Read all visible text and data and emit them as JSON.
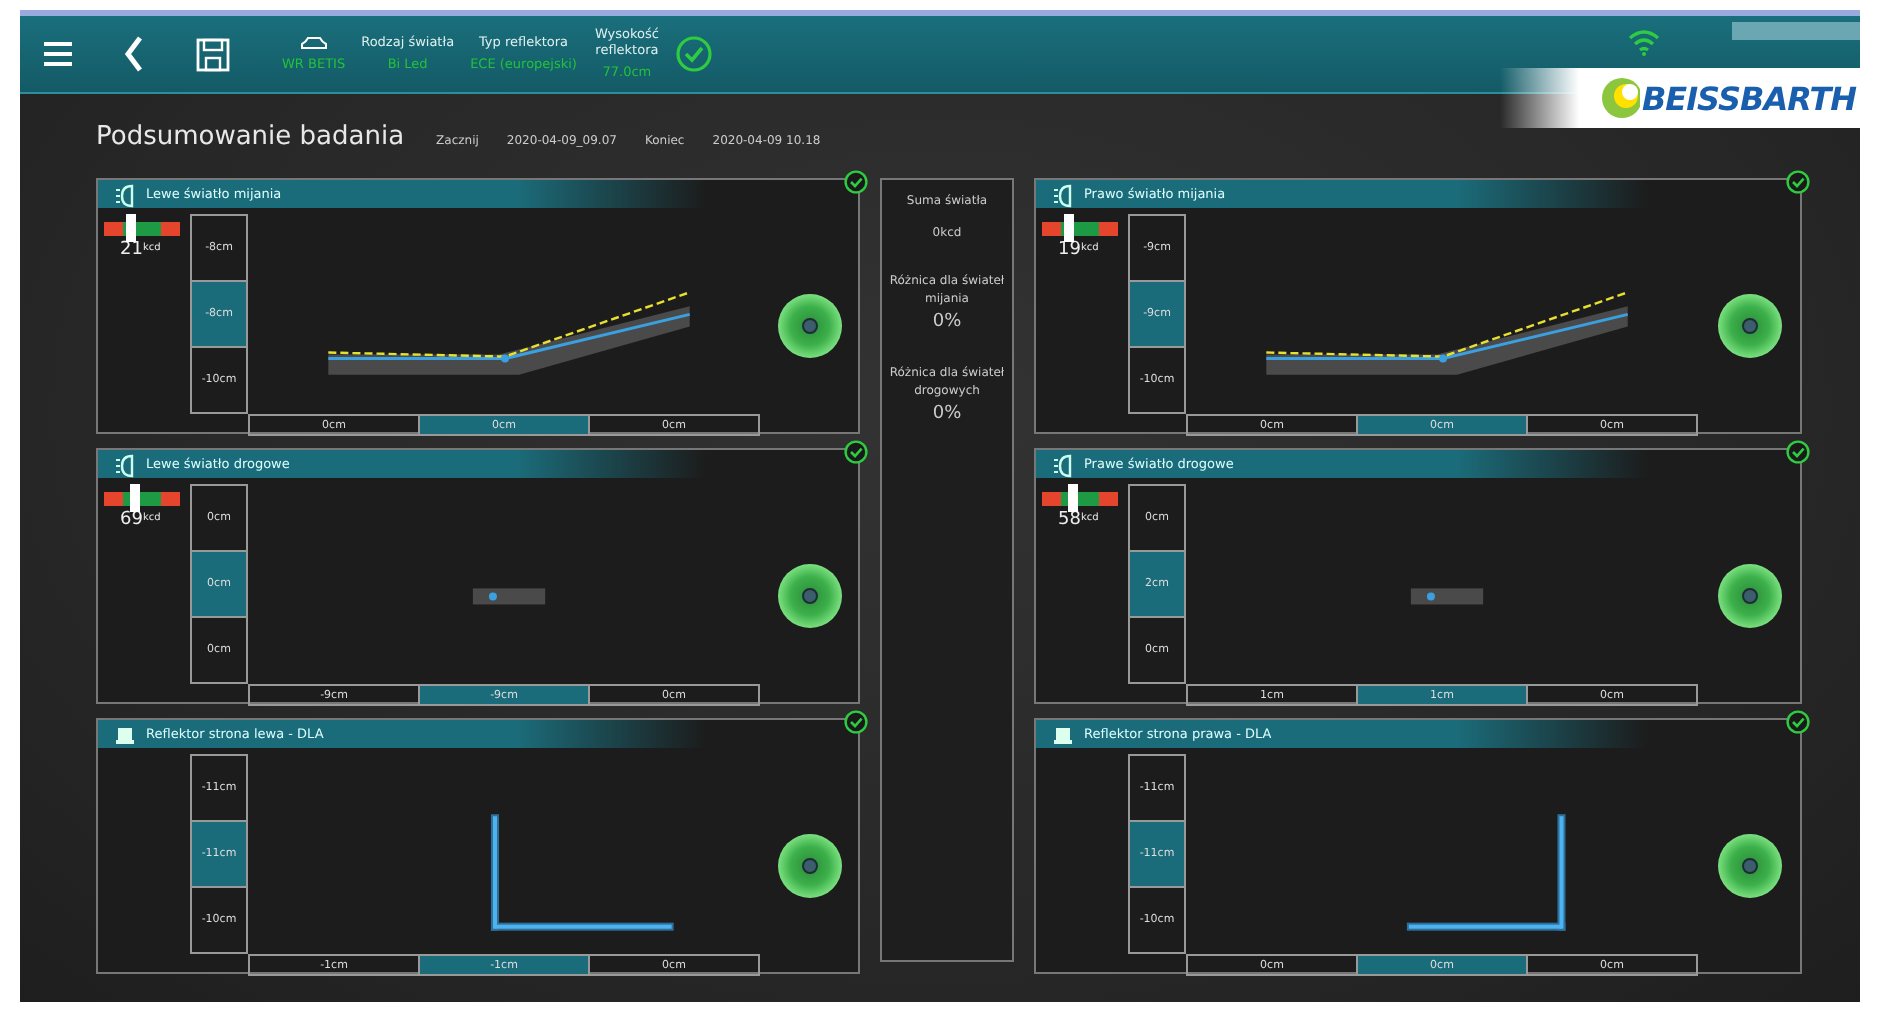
{
  "top_bar": {
    "vehicle": "WR BETIS",
    "fields": [
      {
        "label": "Rodzaj światła",
        "value": "Bi Led"
      },
      {
        "label": "Typ reflektora",
        "value": "ECE (europejski)"
      },
      {
        "label": "Wysokość reflektora",
        "value": "77.0cm"
      }
    ],
    "status_ok": true,
    "wifi_on": true,
    "logo": "BEISSBARTH"
  },
  "summary_header": {
    "title": "Podsumowanie badania",
    "start_label": "Zacznij",
    "start": "2020-04-09_09.07",
    "end_label": "Koniec",
    "end": "2020-04-09 10.18"
  },
  "panels": {
    "left": [
      {
        "kind": "low",
        "title": "Lewe światło mijania",
        "ok": true,
        "gauge": {
          "value": "21",
          "unit": "kcd",
          "level": 0.35
        },
        "vscale": [
          {
            "value": "-8cm",
            "selected": false
          },
          {
            "value": "-8cm",
            "selected": true
          },
          {
            "value": "-10cm",
            "selected": false
          }
        ],
        "hscale": [
          {
            "value": "0cm",
            "selected": false
          },
          {
            "value": "0cm",
            "selected": true
          },
          {
            "value": "0cm",
            "selected": false
          }
        ]
      },
      {
        "kind": "high",
        "title": "Lewe światło drogowe",
        "ok": true,
        "gauge": {
          "value": "69",
          "unit": "kcd",
          "level": 0.4
        },
        "vscale": [
          {
            "value": "0cm",
            "selected": false
          },
          {
            "value": "0cm",
            "selected": true
          },
          {
            "value": "0cm",
            "selected": false
          }
        ],
        "hscale": [
          {
            "value": "-9cm",
            "selected": false
          },
          {
            "value": "-9cm",
            "selected": true
          },
          {
            "value": "0cm",
            "selected": false
          }
        ]
      },
      {
        "kind": "dla",
        "mirrored": false,
        "title": "Reflektor strona lewa - DLA",
        "ok": true,
        "vscale": [
          {
            "value": "-11cm",
            "selected": false
          },
          {
            "value": "-11cm",
            "selected": true
          },
          {
            "value": "-10cm",
            "selected": false
          }
        ],
        "hscale": [
          {
            "value": "-1cm",
            "selected": false
          },
          {
            "value": "-1cm",
            "selected": true
          },
          {
            "value": "0cm",
            "selected": false
          }
        ]
      }
    ],
    "right": [
      {
        "kind": "low",
        "title": "Prawo światło mijania",
        "ok": true,
        "gauge": {
          "value": "19",
          "unit": "kcd",
          "level": 0.35
        },
        "vscale": [
          {
            "value": "-9cm",
            "selected": false
          },
          {
            "value": "-9cm",
            "selected": true
          },
          {
            "value": "-10cm",
            "selected": false
          }
        ],
        "hscale": [
          {
            "value": "0cm",
            "selected": false
          },
          {
            "value": "0cm",
            "selected": true
          },
          {
            "value": "0cm",
            "selected": false
          }
        ]
      },
      {
        "kind": "high",
        "title": "Prawe światło drogowe",
        "ok": true,
        "gauge": {
          "value": "58",
          "unit": "kcd",
          "level": 0.4
        },
        "vscale": [
          {
            "value": "0cm",
            "selected": false
          },
          {
            "value": "2cm",
            "selected": true
          },
          {
            "value": "0cm",
            "selected": false
          }
        ],
        "hscale": [
          {
            "value": "1cm",
            "selected": false
          },
          {
            "value": "1cm",
            "selected": true
          },
          {
            "value": "0cm",
            "selected": false
          }
        ]
      },
      {
        "kind": "dla",
        "mirrored": true,
        "title": "Reflektor strona prawa - DLA",
        "ok": true,
        "vscale": [
          {
            "value": "-11cm",
            "selected": false
          },
          {
            "value": "-11cm",
            "selected": true
          },
          {
            "value": "-10cm",
            "selected": false
          }
        ],
        "hscale": [
          {
            "value": "0cm",
            "selected": false
          },
          {
            "value": "0cm",
            "selected": true
          },
          {
            "value": "0cm",
            "selected": false
          }
        ]
      }
    ]
  },
  "totals": [
    {
      "label": "Suma światła",
      "value": "0kcd",
      "kind": "small"
    },
    {
      "label": "Różnica dla świateł mijania",
      "value": "0%",
      "kind": "large"
    },
    {
      "label": "Różnica dla świateł drogowych",
      "value": "0%",
      "kind": "large"
    }
  ]
}
